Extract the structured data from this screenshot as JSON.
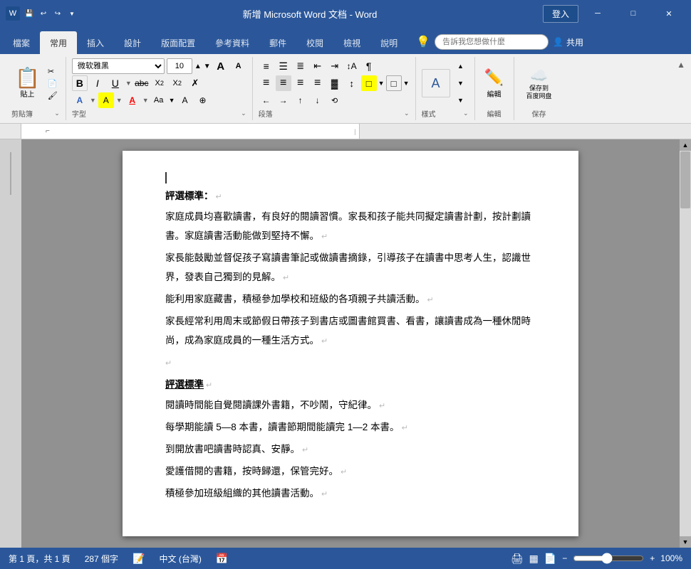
{
  "titleBar": {
    "title": "新增 Microsoft Word 文档 - Word",
    "loginBtn": "登入",
    "undoIcon": "↩",
    "redoIcon": "↪",
    "minimizeIcon": "─",
    "maximizeIcon": "□",
    "closeIcon": "✕"
  },
  "tabs": [
    {
      "label": "檔案",
      "active": false
    },
    {
      "label": "常用",
      "active": true
    },
    {
      "label": "插入",
      "active": false
    },
    {
      "label": "設計",
      "active": false
    },
    {
      "label": "版面配置",
      "active": false
    },
    {
      "label": "參考資料",
      "active": false
    },
    {
      "label": "郵件",
      "active": false
    },
    {
      "label": "校閱",
      "active": false
    },
    {
      "label": "檢視",
      "active": false
    },
    {
      "label": "說明",
      "active": false
    }
  ],
  "ribbon": {
    "groups": [
      {
        "label": "剪貼簿",
        "expand": "⌄"
      },
      {
        "label": "字型",
        "expand": "⌄"
      },
      {
        "label": "段落",
        "expand": "⌄"
      },
      {
        "label": "樣式",
        "expand": "⌄"
      },
      {
        "label": "編輯"
      },
      {
        "label": "保存"
      }
    ],
    "fontName": "微软雅黑",
    "fontSize": "10",
    "tipPlaceholder": "告訴我您想做什麼",
    "shareBtn": "共用",
    "saveToCloudBtn": "保存到\n百度网盘",
    "saveBtn": "保存"
  },
  "document": {
    "paragraphs": [
      {
        "type": "heading",
        "text": "評選標準：",
        "mark": "↵"
      },
      {
        "type": "body",
        "text": "家庭成員均喜歡讀書，有良好的閱讀習慣。家長和孩子能共同擬定讀書計劃，按計劃讀書。家庭讀書活動能做到堅持不懈。",
        "mark": "↵"
      },
      {
        "type": "body",
        "text": "家長能鼓勵並督促孩子寫讀書筆記或做讀書摘錄，引導孩子在讀書中思考人生，認識世界，發表自己獨到的見解。",
        "mark": "↵"
      },
      {
        "type": "body",
        "text": "能利用家庭藏書，積極參加學校和班級的各項親子共讀活動。",
        "mark": "↵"
      },
      {
        "type": "body",
        "text": "家長經常利用周末或節假日帶孩子到書店或圖書館買書、看書，讓讀書成為一種休閒時尚，成為家庭成員的一種生活方式。",
        "mark": "↵"
      },
      {
        "type": "blank",
        "mark": "↵"
      },
      {
        "type": "heading2",
        "text": "評選標準",
        "mark": "↵"
      },
      {
        "type": "body",
        "text": "閱讀時間能自覺閱讀課外書籍，不吵鬧，守紀律。",
        "mark": "↵"
      },
      {
        "type": "body",
        "text": "每學期能讀 5—8 本書，讀書節期間能讀完 1—2 本書。",
        "mark": "↵"
      },
      {
        "type": "body",
        "text": "到開放書吧讀書時認真、安靜。",
        "mark": "↵"
      },
      {
        "type": "body",
        "text": "愛護借閱的書籍，按時歸還，保管完好。",
        "mark": "↵"
      },
      {
        "type": "body",
        "text": "積極參加班級組織的其他讀書活動。",
        "mark": "↵"
      }
    ]
  },
  "statusBar": {
    "page": "第 1 頁，共 1 頁",
    "wordCount": "287 個字",
    "lang": "中文 (台灣)",
    "zoom": "100%"
  }
}
